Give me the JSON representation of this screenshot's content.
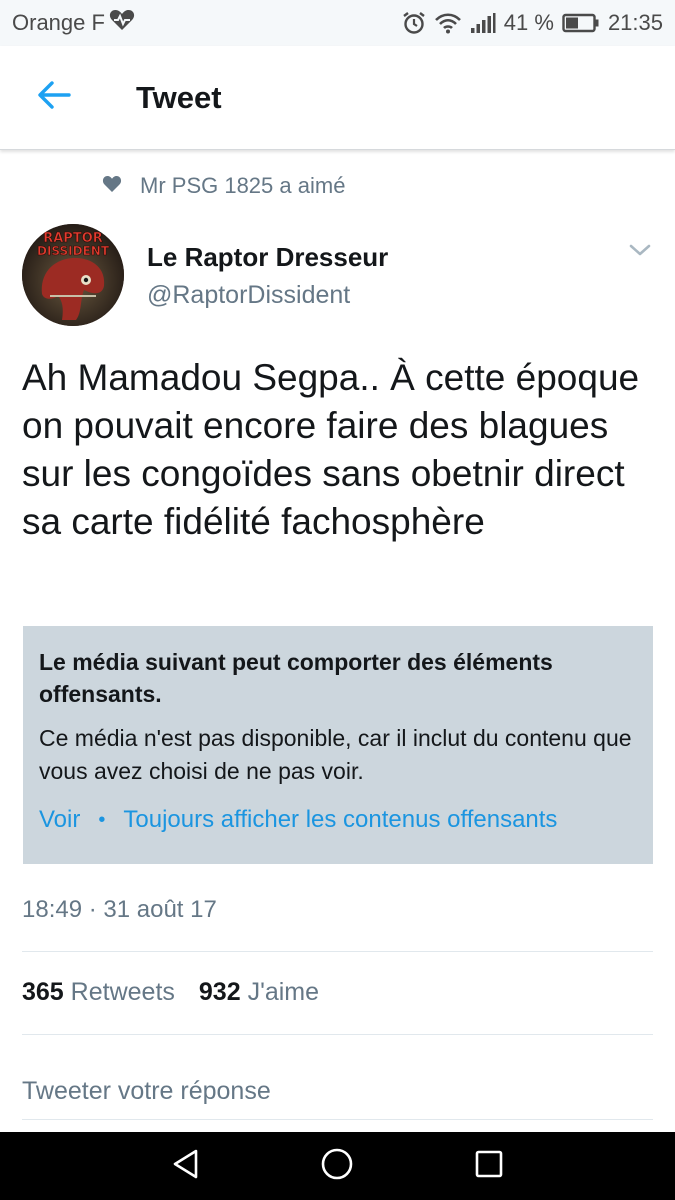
{
  "status_bar": {
    "carrier": "Orange F",
    "battery_percent": "41 %",
    "time": "21:35",
    "icons": [
      "heart-pulse-icon",
      "alarm-icon",
      "wifi-icon",
      "signal-icon",
      "battery-icon"
    ]
  },
  "header": {
    "title": "Tweet",
    "back_icon": "arrow-left-icon"
  },
  "social_context": {
    "icon": "heart-icon",
    "text": "Mr PSG 1825 a aimé"
  },
  "author": {
    "name": "Le Raptor Dresseur",
    "handle": "@RaptorDissident",
    "avatar_text": "RAPTOR DISSIDENT"
  },
  "tweet": {
    "text": "Ah Mamadou Segpa.. À cette époque on pouvait encore faire des blagues sur les congoïdes sans obetnir direct sa carte fidélité fachosphère"
  },
  "media_warning": {
    "title": "Le média suivant peut comporter des éléments offensants.",
    "body": "Ce média n'est pas disponible, car il inclut du contenu que vous avez choisi de ne pas voir.",
    "view_label": "Voir",
    "separator": "•",
    "always_show_label": "Toujours afficher les contenus offensants"
  },
  "timestamp": "18:49 · 31 août 17",
  "stats": {
    "retweets_count": "365",
    "retweets_label": "Retweets",
    "likes_count": "932",
    "likes_label": "J'aime"
  },
  "reply": {
    "placeholder": "Tweeter votre réponse"
  },
  "colors": {
    "accent": "#1b95e0",
    "muted": "#657786",
    "warning_bg": "#ccd6dd"
  }
}
